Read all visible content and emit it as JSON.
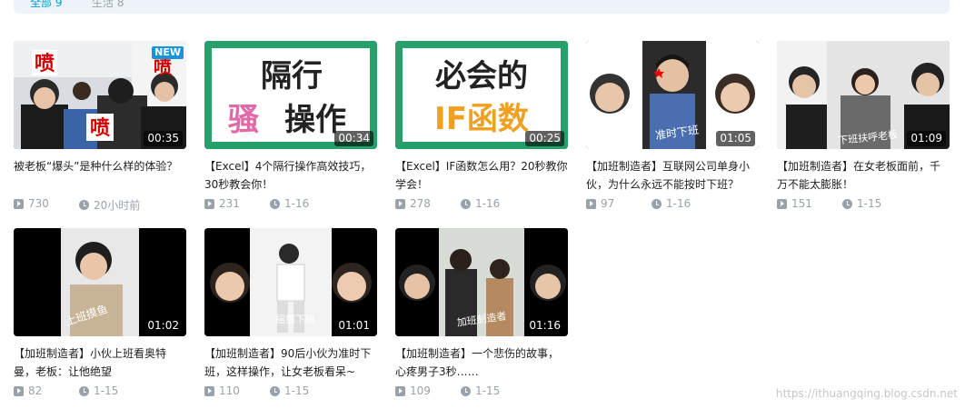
{
  "tabs": {
    "all": "全部",
    "all_count": "9",
    "life": "生活",
    "life_count": "8"
  },
  "videos": [
    {
      "title": "被老板“爆头”是种什么样的体验？",
      "plays": "730",
      "time": "20小时前",
      "duration": "00:35",
      "badge": "NEW",
      "thumb_text": [
        "喷",
        "喷",
        "喷"
      ]
    },
    {
      "title": "【Excel】4个隔行操作高效技巧，30秒教会你！",
      "plays": "231",
      "time": "1-16",
      "duration": "00:34",
      "thumb_text": [
        "隔行",
        "骚",
        "操作"
      ]
    },
    {
      "title": "【Excel】IF函数怎么用？20秒教你学会！",
      "plays": "278",
      "time": "1-16",
      "duration": "00:25",
      "thumb_text": [
        "必会的",
        "IF函数"
      ]
    },
    {
      "title": "【加班制造者】互联网公司单身小伙，为什么永远不能按时下班？",
      "plays": "97",
      "time": "1-16",
      "duration": "01:05",
      "thumb_text": [
        "准时下班"
      ]
    },
    {
      "title": "【加班制造者】在女老板面前，千万不能太膨胀！",
      "plays": "151",
      "time": "1-15",
      "duration": "01:09",
      "thumb_text": [
        "下班扶呼老板"
      ]
    },
    {
      "title": "【加班制造者】小伙上班看奥特曼，老板：让他绝望",
      "plays": "82",
      "time": "1-15",
      "duration": "01:02",
      "thumb_text": [
        "上班摸鱼"
      ]
    },
    {
      "title": "【加班制造者】90后小伙为准时下班，这样操作，让女老板看呆~",
      "plays": "110",
      "time": "1-15",
      "duration": "01:01",
      "thumb_text": [
        "摇摆下班"
      ]
    },
    {
      "title": "【加班制造者】一个悲伤的故事，心疼男子3秒……",
      "plays": "109",
      "time": "1-15",
      "duration": "01:16",
      "thumb_text": [
        "加班制造者"
      ]
    }
  ],
  "watermark": "https://ithuangqing.blog.csdn.net"
}
